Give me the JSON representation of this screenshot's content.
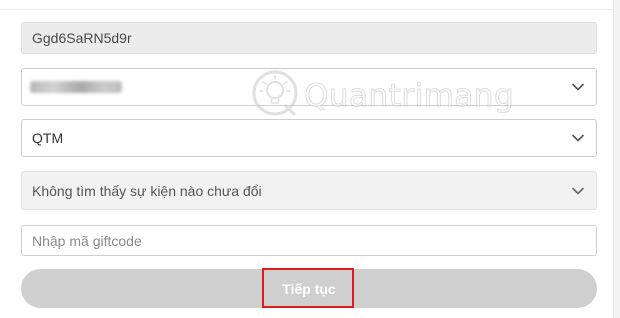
{
  "form": {
    "account_id": {
      "value": "Ggd6SaRN5d9r"
    },
    "server_select": {
      "value_visible": false
    },
    "character_select": {
      "value": "QTM"
    },
    "event_select": {
      "value": "Không tìm thấy sự kiện nào chưa đổi"
    },
    "giftcode_input": {
      "placeholder": "Nhập mã giftcode",
      "value": ""
    },
    "submit_button": {
      "label": "Tiếp tục"
    }
  },
  "watermark": {
    "text": "Quantrimang",
    "icon": "lightbulb-logo"
  },
  "colors": {
    "highlight": "#e01c1c",
    "button_disabled": "#cfcfcf"
  }
}
